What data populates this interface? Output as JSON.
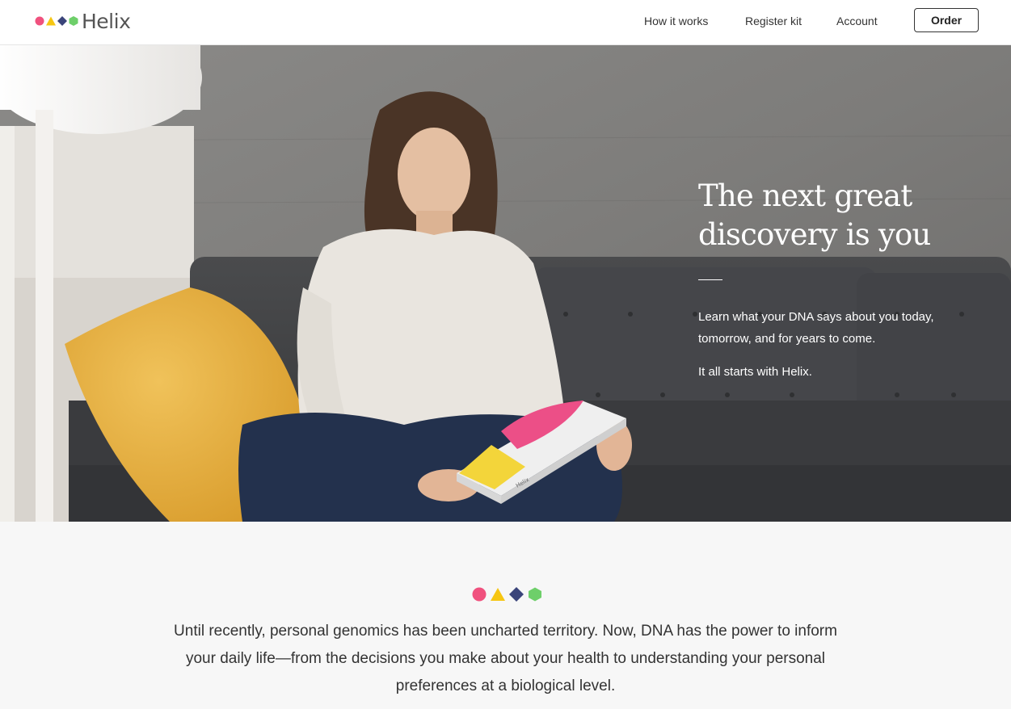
{
  "brand": {
    "name": "Helix",
    "colors": {
      "pink": "#f0517e",
      "yellow": "#f6c612",
      "navy": "#3a447a",
      "green": "#6ecf6a"
    }
  },
  "nav": {
    "items": [
      {
        "label": "How it works"
      },
      {
        "label": "Register kit"
      },
      {
        "label": "Account"
      }
    ],
    "order_label": "Order"
  },
  "hero": {
    "title": "The next great discovery is you",
    "paragraph1": "Learn what your DNA says about you today, tomorrow, and for years to come.",
    "paragraph2": "It all starts with Helix.",
    "kit_label": "Helix"
  },
  "intro": {
    "text": "Until recently, personal genomics has been uncharted territory. Now, DNA has the power to inform your daily life—from the decisions you make about your health to understanding your personal preferences at a biological level."
  }
}
